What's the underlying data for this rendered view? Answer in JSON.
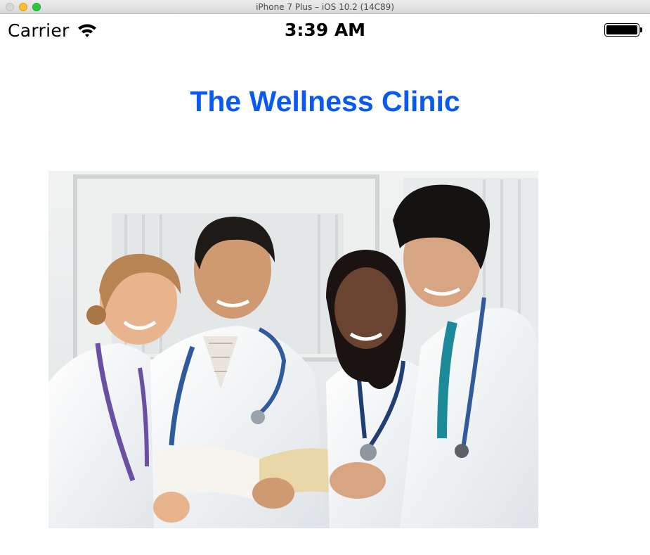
{
  "window": {
    "title": "iPhone 7 Plus – iOS 10.2 (14C89)"
  },
  "status_bar": {
    "carrier": "Carrier",
    "time": "3:39 AM",
    "battery_level": 1.0,
    "icons": [
      "wifi-icon",
      "battery-icon"
    ]
  },
  "app": {
    "title": "The Wellness Clinic",
    "title_color": "#0a59f0",
    "hero_image": "photo of four smiling doctors in white coats with stethoscopes"
  }
}
